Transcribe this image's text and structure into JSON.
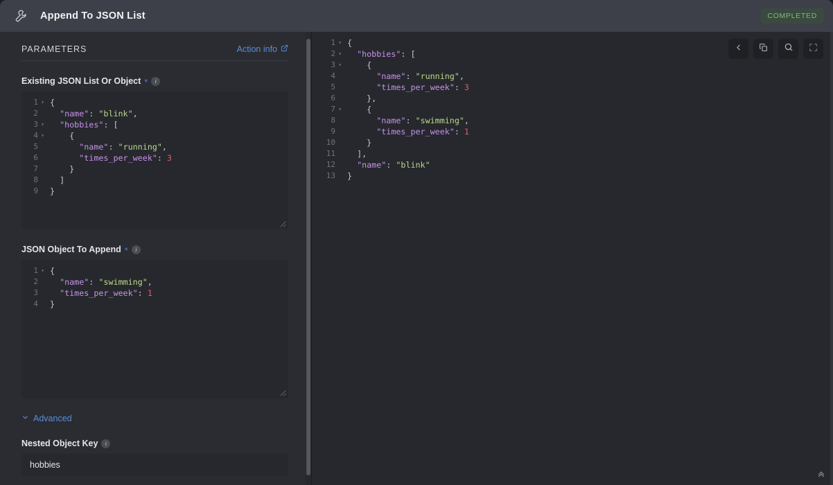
{
  "header": {
    "icon": "wrench-icon",
    "title": "Append To JSON List",
    "status": "COMPLETED",
    "status_color": "#7fba83"
  },
  "left_panel": {
    "section_label": "PARAMETERS",
    "action_info_label": "Action info",
    "action_info_icon": "external-link-icon",
    "fields": [
      {
        "label": "Existing JSON List Or Object",
        "required_marker": "*",
        "info_icon": "info-icon",
        "editor": {
          "lines": [
            {
              "num": "1",
              "fold": true,
              "tokens": [
                {
                  "t": "{",
                  "c": "p"
                }
              ]
            },
            {
              "num": "2",
              "fold": false,
              "tokens": [
                {
                  "t": "  \"name\"",
                  "c": "k"
                },
                {
                  "t": ": ",
                  "c": "p"
                },
                {
                  "t": "\"blink\"",
                  "c": "s"
                },
                {
                  "t": ",",
                  "c": "p"
                }
              ]
            },
            {
              "num": "3",
              "fold": true,
              "tokens": [
                {
                  "t": "  \"hobbies\"",
                  "c": "k"
                },
                {
                  "t": ": [",
                  "c": "p"
                }
              ]
            },
            {
              "num": "4",
              "fold": true,
              "tokens": [
                {
                  "t": "    {",
                  "c": "p"
                }
              ]
            },
            {
              "num": "5",
              "fold": false,
              "tokens": [
                {
                  "t": "      \"name\"",
                  "c": "k"
                },
                {
                  "t": ": ",
                  "c": "p"
                },
                {
                  "t": "\"running\"",
                  "c": "s"
                },
                {
                  "t": ",",
                  "c": "p"
                }
              ]
            },
            {
              "num": "6",
              "fold": false,
              "tokens": [
                {
                  "t": "      \"times_per_week\"",
                  "c": "k"
                },
                {
                  "t": ": ",
                  "c": "p"
                },
                {
                  "t": "3",
                  "c": "n"
                }
              ]
            },
            {
              "num": "7",
              "fold": false,
              "tokens": [
                {
                  "t": "    }",
                  "c": "p"
                }
              ]
            },
            {
              "num": "8",
              "fold": false,
              "tokens": [
                {
                  "t": "  ]",
                  "c": "p"
                }
              ]
            },
            {
              "num": "9",
              "fold": false,
              "tokens": [
                {
                  "t": "}",
                  "c": "p"
                }
              ]
            }
          ]
        }
      },
      {
        "label": "JSON Object To Append",
        "required_marker": "*",
        "info_icon": "info-icon",
        "editor": {
          "lines": [
            {
              "num": "1",
              "fold": true,
              "tokens": [
                {
                  "t": "{",
                  "c": "p"
                }
              ]
            },
            {
              "num": "2",
              "fold": false,
              "tokens": [
                {
                  "t": "  \"name\"",
                  "c": "k"
                },
                {
                  "t": ": ",
                  "c": "p"
                },
                {
                  "t": "\"swimming\"",
                  "c": "s"
                },
                {
                  "t": ",",
                  "c": "p"
                }
              ]
            },
            {
              "num": "3",
              "fold": false,
              "tokens": [
                {
                  "t": "  \"times_per_week\"",
                  "c": "k"
                },
                {
                  "t": ": ",
                  "c": "p"
                },
                {
                  "t": "1",
                  "c": "n"
                }
              ]
            },
            {
              "num": "4",
              "fold": false,
              "tokens": [
                {
                  "t": "}",
                  "c": "p"
                }
              ]
            }
          ]
        }
      }
    ],
    "advanced": {
      "label": "Advanced",
      "icon": "chevron-down-icon",
      "expanded": true
    },
    "nested_key_field": {
      "label": "Nested Object Key",
      "info_icon": "info-icon",
      "value": "hobbies"
    }
  },
  "right_panel": {
    "toolbar": [
      {
        "name": "back-button",
        "icon": "chevron-left-icon"
      },
      {
        "name": "copy-button",
        "icon": "copy-icon"
      },
      {
        "name": "search-button",
        "icon": "search-icon"
      },
      {
        "name": "fullscreen-button",
        "icon": "fullscreen-icon"
      }
    ],
    "scroll_top_icon": "double-chevron-up-icon",
    "output": {
      "lines": [
        {
          "num": "1",
          "fold": true,
          "tokens": [
            {
              "t": "{",
              "c": "p"
            }
          ]
        },
        {
          "num": "2",
          "fold": true,
          "tokens": [
            {
              "t": "  \"hobbies\"",
              "c": "k"
            },
            {
              "t": ": [",
              "c": "p"
            }
          ]
        },
        {
          "num": "3",
          "fold": true,
          "tokens": [
            {
              "t": "    {",
              "c": "p"
            }
          ]
        },
        {
          "num": "4",
          "fold": false,
          "tokens": [
            {
              "t": "      \"name\"",
              "c": "k"
            },
            {
              "t": ": ",
              "c": "p"
            },
            {
              "t": "\"running\"",
              "c": "s"
            },
            {
              "t": ",",
              "c": "p"
            }
          ]
        },
        {
          "num": "5",
          "fold": false,
          "tokens": [
            {
              "t": "      \"times_per_week\"",
              "c": "k"
            },
            {
              "t": ": ",
              "c": "p"
            },
            {
              "t": "3",
              "c": "n"
            }
          ]
        },
        {
          "num": "6",
          "fold": false,
          "tokens": [
            {
              "t": "    },",
              "c": "p"
            }
          ]
        },
        {
          "num": "7",
          "fold": true,
          "tokens": [
            {
              "t": "    {",
              "c": "p"
            }
          ]
        },
        {
          "num": "8",
          "fold": false,
          "tokens": [
            {
              "t": "      \"name\"",
              "c": "k"
            },
            {
              "t": ": ",
              "c": "p"
            },
            {
              "t": "\"swimming\"",
              "c": "s"
            },
            {
              "t": ",",
              "c": "p"
            }
          ]
        },
        {
          "num": "9",
          "fold": false,
          "tokens": [
            {
              "t": "      \"times_per_week\"",
              "c": "k"
            },
            {
              "t": ": ",
              "c": "p"
            },
            {
              "t": "1",
              "c": "n"
            }
          ]
        },
        {
          "num": "10",
          "fold": false,
          "tokens": [
            {
              "t": "    }",
              "c": "p"
            }
          ]
        },
        {
          "num": "11",
          "fold": false,
          "tokens": [
            {
              "t": "  ],",
              "c": "p"
            }
          ]
        },
        {
          "num": "12",
          "fold": false,
          "tokens": [
            {
              "t": "  \"name\"",
              "c": "k"
            },
            {
              "t": ": ",
              "c": "p"
            },
            {
              "t": "\"blink\"",
              "c": "s"
            }
          ]
        },
        {
          "num": "13",
          "fold": false,
          "tokens": [
            {
              "t": "}",
              "c": "p"
            }
          ]
        }
      ]
    }
  }
}
